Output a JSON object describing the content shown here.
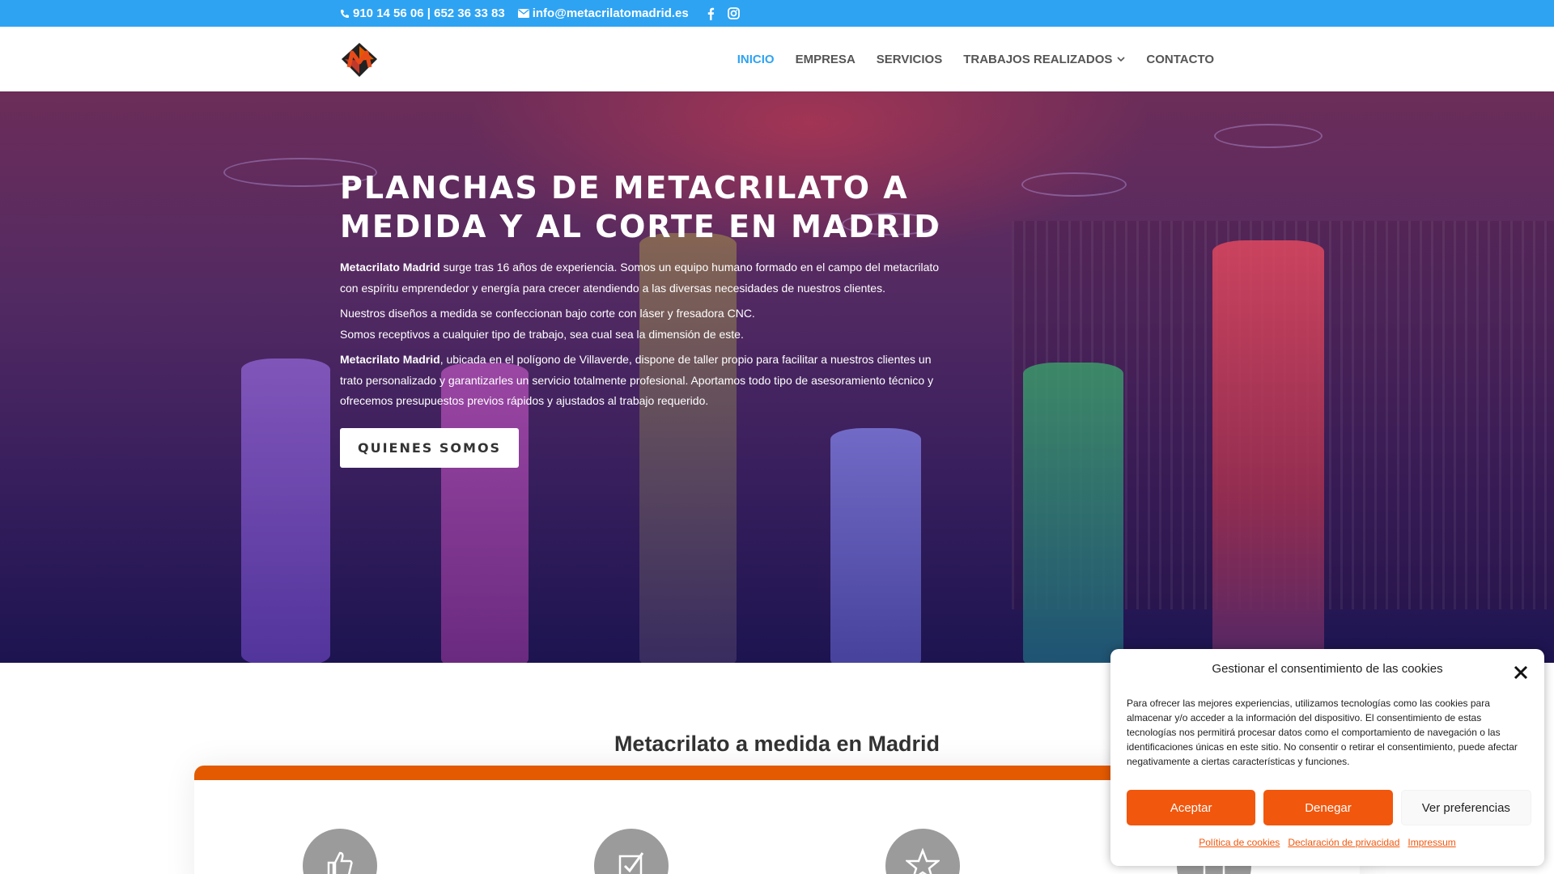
{
  "topbar": {
    "phone": "910 14 56 06 | 652 36 33 83",
    "email": "info@metacrilatomadrid.es",
    "phone_icon": "phone-icon",
    "email_icon": "envelope-icon",
    "social_icons": [
      "facebook-icon",
      "instagram-icon"
    ],
    "bg_color": "#2ea3f2"
  },
  "nav": {
    "items": [
      {
        "label": "INICIO",
        "active": true
      },
      {
        "label": "EMPRESA"
      },
      {
        "label": "SERVICIOS"
      },
      {
        "label": "TRABAJOS REALIZADOS",
        "dropdown": true
      },
      {
        "label": "CONTACTO"
      }
    ],
    "active_color": "#2ea3f2"
  },
  "hero": {
    "title": "PLANCHAS DE METACRILATO A MEDIDA Y AL CORTE EN MADRID",
    "p1_bold": "Metacrilato Madrid",
    "p1_rest": " surge tras 16 años de experiencia. Somos un equipo humano formado en el campo del metacrilato con espíritu emprendedor y energía para crecer atendiendo a las diversas necesidades de nuestros clientes.",
    "p2_line1": "Nuestros diseños a medida se confeccionan bajo corte con láser y fresadora CNC.",
    "p2_line2": "Somos receptivos a cualquier tipo de trabajo, sea cual sea la dimensión de este.",
    "p3_bold": "Metacrilato Madrid",
    "p3_rest": ", ubicada en el polígono de Villaverde, dispone de taller propio para facilitar a nuestros clientes un trato personalizado y garantizarles un servicio totalmente profesional. Aportamos todo tipo de asesoramiento técnico y ofrecemos presupuestos previos rápidos y ajustados al trabajo requerido.",
    "button": "QUIENES SOMOS"
  },
  "section": {
    "title": "Metacrilato a medida en Madrid",
    "accent_color": "#e35a00",
    "feature_icons": [
      "thumbs-up-icon",
      "checkbox-icon",
      "star-icon",
      "building-icon"
    ]
  },
  "cookie": {
    "title": "Gestionar el consentimiento de las cookies",
    "text": "Para ofrecer las mejores experiencias, utilizamos tecnologías como las cookies para almacenar y/o acceder a la información del dispositivo. El consentimiento de estas tecnologías nos permitirá procesar datos como el comportamiento de navegación o las identificaciones únicas en este sitio. No consentir o retirar el consentimiento, puede afectar negativamente a ciertas características y funciones.",
    "accept": "Aceptar",
    "deny": "Denegar",
    "preferences": "Ver preferencias",
    "links": [
      "Política de cookies",
      "Declaración de privacidad",
      "Impressum"
    ],
    "accent_color": "#f1570d"
  }
}
